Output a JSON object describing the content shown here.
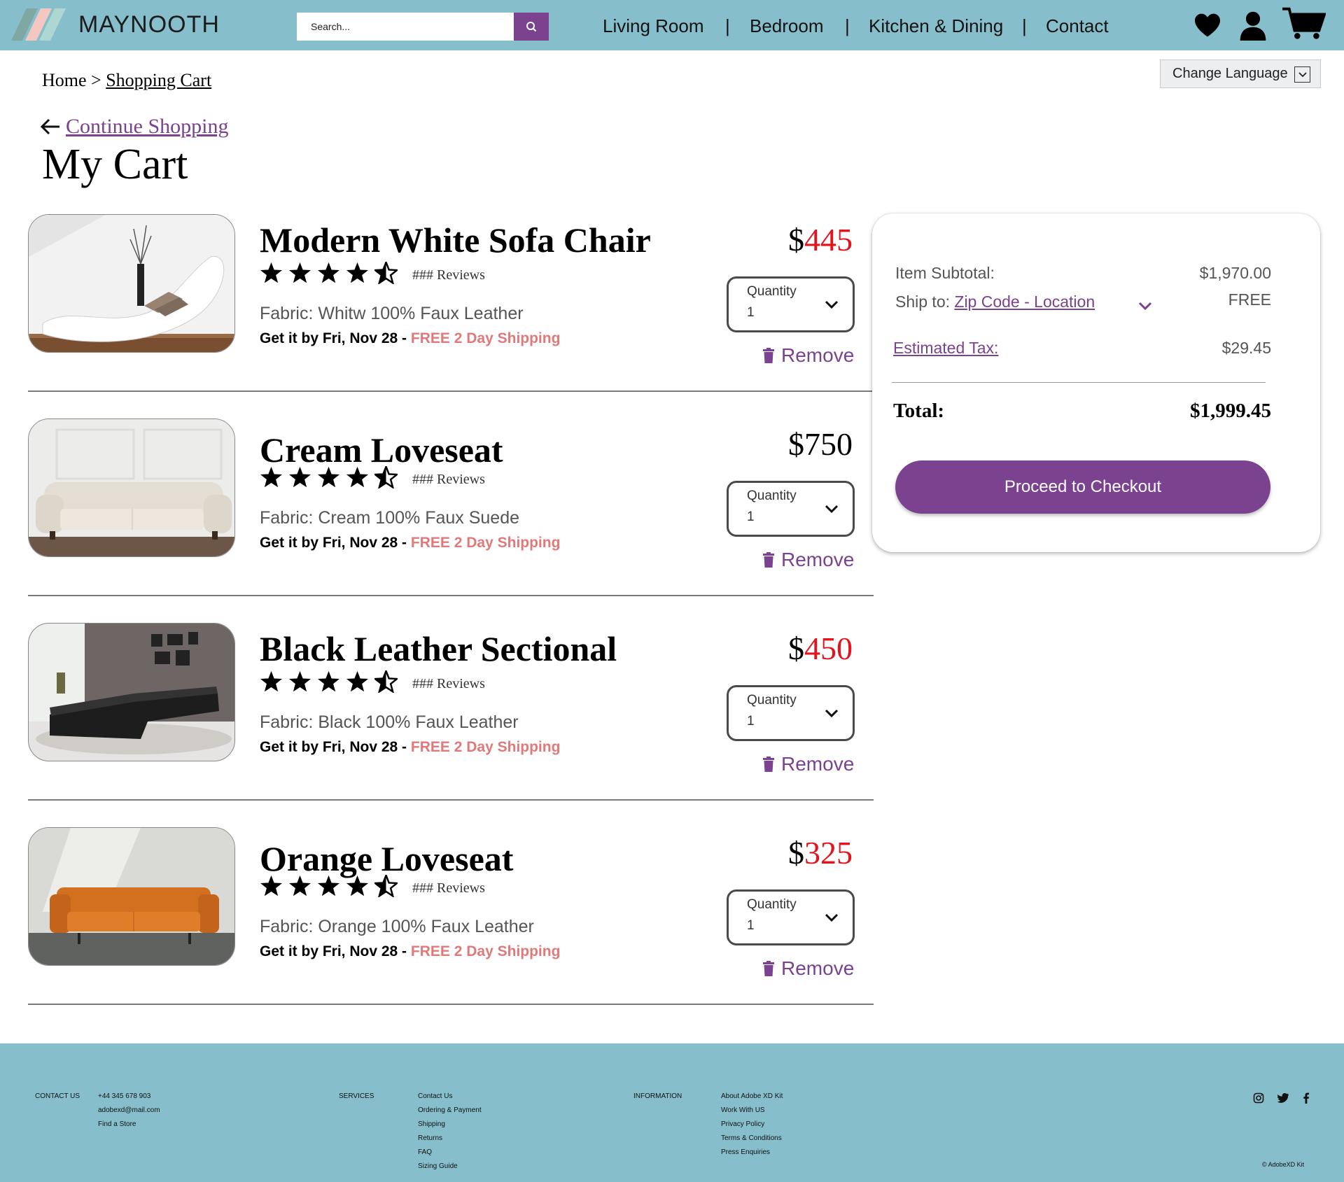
{
  "header": {
    "brand": "MAYNOOTH",
    "search_placeholder": "Search...",
    "nav": [
      "Living Room",
      "Bedroom",
      "Kitchen & Dining",
      "Contact"
    ],
    "nav_separator": "|"
  },
  "breadcrumb": {
    "home": "Home",
    "sep": ">",
    "current": "Shopping Cart"
  },
  "language": {
    "label": "Change Language"
  },
  "continue_label": "Continue Shopping",
  "page_title": "My Cart",
  "items": [
    {
      "name": "Modern White Sofa Chair",
      "reviews": "### Reviews",
      "fabric": "Fabric: Whitw 100% Faux Leather",
      "delivery": "Get it by Fri, Nov 28 - ",
      "shipping": "FREE 2 Day Shipping",
      "currency": "$",
      "price": "445",
      "price_red": true,
      "qty_label": "Quantity",
      "qty": "1",
      "remove": "Remove",
      "rating": 4.5
    },
    {
      "name": "Cream Loveseat",
      "reviews": "### Reviews",
      "fabric": "Fabric: Cream 100% Faux Suede",
      "delivery": "Get it by Fri, Nov 28 - ",
      "shipping": "FREE 2 Day Shipping",
      "currency": "$",
      "price": "750",
      "price_red": false,
      "qty_label": "Quantity",
      "qty": "1",
      "remove": "Remove",
      "rating": 4.5
    },
    {
      "name": "Black Leather Sectional",
      "reviews": "### Reviews",
      "fabric": "Fabric: Black 100% Faux Leather",
      "delivery": "Get it by Fri, Nov 28 - ",
      "shipping": "FREE 2 Day Shipping",
      "currency": "$",
      "price": "450",
      "price_red": true,
      "qty_label": "Quantity",
      "qty": "1",
      "remove": "Remove",
      "rating": 4.5
    },
    {
      "name": "Orange Loveseat",
      "reviews": "### Reviews",
      "fabric": "Fabric: Orange 100% Faux Leather",
      "delivery": "Get it by Fri, Nov 28 - ",
      "shipping": "FREE 2 Day Shipping",
      "currency": "$",
      "price": "325",
      "price_red": true,
      "qty_label": "Quantity",
      "qty": "1",
      "remove": "Remove",
      "rating": 4.5
    }
  ],
  "summary": {
    "subtotal_label": "Item Subtotal:",
    "subtotal_value": "$1,970.00",
    "ship_label": "Ship to:",
    "ship_link": "Zip Code - Location",
    "ship_value": "FREE",
    "tax_label": "Estimated Tax:",
    "tax_value": "$29.45",
    "total_label": "Total:",
    "total_value": "$1,999.45",
    "checkout_label": "Proceed to Checkout"
  },
  "footer": {
    "contact_heading": "CONTACT US",
    "contact_items": [
      "+44 345 678 903",
      "adobexd@mail.com",
      "Find a Store"
    ],
    "services_heading": "SERVICES",
    "services_items": [
      "Contact Us",
      "Ordering & Payment",
      "Shipping",
      "Returns",
      "FAQ",
      "Sizing Guide"
    ],
    "info_heading": "INFORMATION",
    "info_items": [
      "About Adobe XD Kit",
      "Work With US",
      "Privacy Policy",
      "Terms & Conditions",
      "Press Enquiries"
    ],
    "copyright": "© AdobeXD Kit"
  },
  "colors": {
    "header_bg": "#86bfcb",
    "accent": "#7a428f",
    "price_red": "#e3141b",
    "shipping": "#e07a7a"
  },
  "icons": [
    "search-icon",
    "heart-icon",
    "user-icon",
    "cart-icon",
    "back-arrow-icon",
    "chevron-down-icon",
    "trash-icon",
    "star-icon",
    "instagram-icon",
    "twitter-icon",
    "facebook-icon"
  ]
}
